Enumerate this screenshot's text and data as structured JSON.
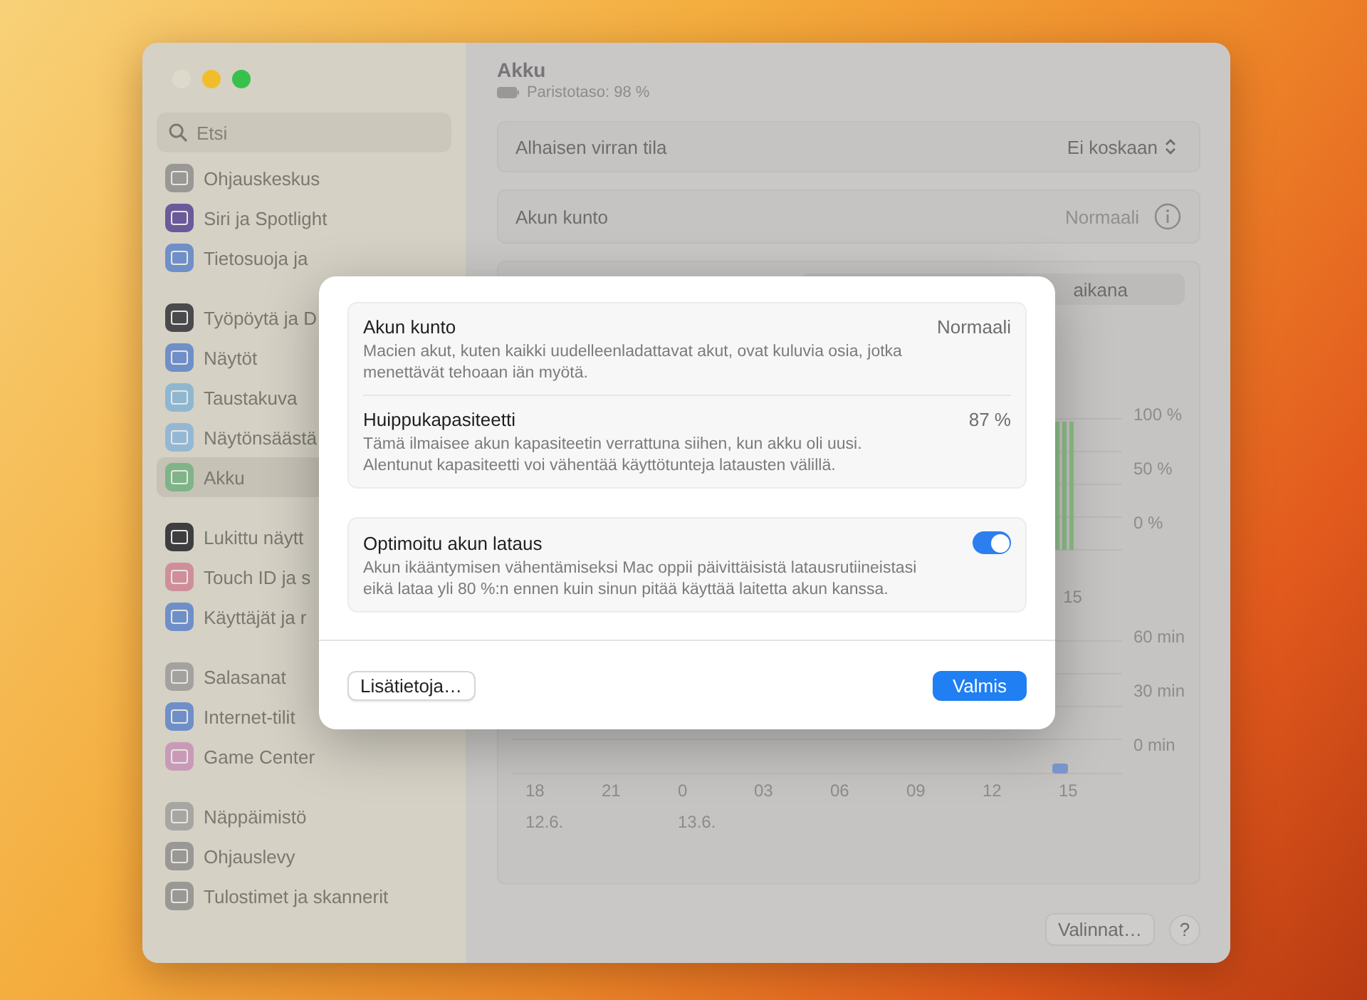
{
  "sidebar": {
    "search": {
      "placeholder": "Etsi"
    },
    "groups": [
      {
        "items": [
          {
            "label": "Ohjauskeskus",
            "selected": false,
            "color": "#9a9894"
          },
          {
            "label": "Siri ja Spotlight",
            "selected": false,
            "color": "#6a5a9a"
          },
          {
            "label": "Tietosuoja ja",
            "selected": false,
            "color": "#6f8fc8"
          }
        ]
      },
      {
        "items": [
          {
            "label": "Työpöytä ja D",
            "selected": false,
            "color": "#4a4a4c"
          },
          {
            "label": "Näytöt",
            "selected": false,
            "color": "#6f8fc8"
          },
          {
            "label": "Taustakuva",
            "selected": false,
            "color": "#8fb8d0"
          },
          {
            "label": "Näytönsäästä",
            "selected": false,
            "color": "#94b8d4"
          },
          {
            "label": "Akku",
            "selected": true,
            "color": "#7fb488"
          }
        ]
      },
      {
        "items": [
          {
            "label": "Lukittu näytt",
            "selected": false,
            "color": "#3e3e40"
          },
          {
            "label": "Touch ID ja s",
            "selected": false,
            "color": "#cf8e9a"
          },
          {
            "label": "Käyttäjät ja r",
            "selected": false,
            "color": "#6f8fc8"
          }
        ]
      },
      {
        "items": [
          {
            "label": "Salasanat",
            "selected": false,
            "color": "#a4a29e"
          },
          {
            "label": "Internet-tilit",
            "selected": false,
            "color": "#6f8fc8"
          },
          {
            "label": "Game Center",
            "selected": false,
            "color": "#c99ab8"
          }
        ]
      },
      {
        "items": [
          {
            "label": "Näppäimistö",
            "selected": false,
            "color": "#a8a6a2"
          },
          {
            "label": "Ohjauslevy",
            "selected": false,
            "color": "#9a9894"
          },
          {
            "label": "Tulostimet ja skannerit",
            "selected": false,
            "color": "#9a9894"
          }
        ]
      }
    ]
  },
  "content": {
    "title": "Akku",
    "subtitle": "Paristotaso: 98 %",
    "rows": [
      {
        "kind": "popup",
        "label": "Alhaisen virran tila",
        "value": "Ei koskaan"
      },
      {
        "kind": "info",
        "label": "Akun kunto",
        "value": "Normaali"
      }
    ],
    "segment": "aikana",
    "top_chart": {
      "y_labels": [
        "100 %",
        "50 %",
        "0 %"
      ],
      "x_labels": [
        "15"
      ]
    },
    "bottom_chart": {
      "y_labels": [
        "60 min",
        "30 min",
        "0 min"
      ],
      "x_labels": [
        {
          "time": "18",
          "date": "12.6."
        },
        {
          "time": "21"
        },
        {
          "time": "0",
          "date": "13.6."
        },
        {
          "time": "03"
        },
        {
          "time": "06"
        },
        {
          "time": "09"
        },
        {
          "time": "12"
        },
        {
          "time": "15"
        }
      ]
    },
    "options_button": "Valinnat…",
    "help_button": "?"
  },
  "sheet": {
    "cards": [
      {
        "rows": [
          {
            "kind": "value",
            "title": "Akun kunto",
            "value": "Normaali",
            "description": "Macien akut, kuten kaikki uudelleenladattavat akut, ovat kuluvia osia, jotka menettävät tehoaan iän myötä."
          },
          {
            "kind": "value",
            "title": "Huippukapasiteetti",
            "value": "87 %",
            "description": "Tämä ilmaisee akun kapasiteetin verrattuna siihen, kun akku oli uusi. Alentunut kapasiteetti voi vähentää käyttötunteja latausten välillä."
          }
        ]
      },
      {
        "rows": [
          {
            "kind": "toggle",
            "title": "Optimoitu akun lataus",
            "on": true,
            "description": "Akun ikääntymisen vähentämiseksi Mac oppii päivittäisistä latausrutiineistasi eikä lataa yli 80 %:n ennen kuin sinun pitää käyttää laitetta akun kanssa."
          }
        ]
      }
    ],
    "secondary_button": "Lisätietoja…",
    "primary_button": "Valmis"
  }
}
